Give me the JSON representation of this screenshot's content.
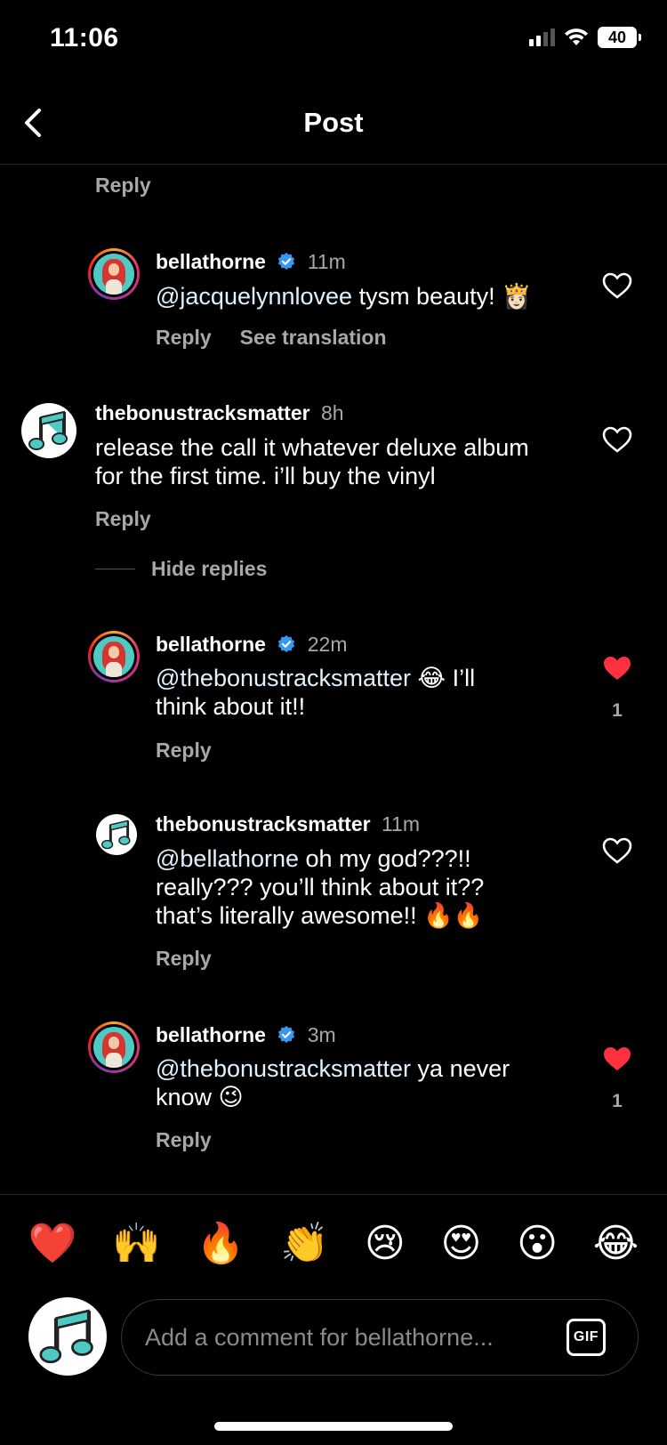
{
  "status": {
    "time": "11:06",
    "battery": "40"
  },
  "nav": {
    "title": "Post"
  },
  "top_reply_label": "Reply",
  "comments": [
    {
      "username": "bellathorne",
      "time": "11m",
      "mention": "@jacquelynnlovee",
      "text": " tysm beauty! 👸🏻",
      "reply": "Reply",
      "translate": "See translation"
    },
    {
      "username": "thebonustracksmatter",
      "time": "8h",
      "text_line1": "release the call it whatever deluxe album",
      "text_line2": "for the first time. i’ll buy the vinyl",
      "reply": "Reply"
    },
    {
      "username": "bellathorne",
      "time": "22m",
      "mention": "@thebonustracksmatter",
      "text_line1": " 😂 I’ll",
      "text_line2": "think about it!!",
      "reply": "Reply",
      "likes": "1"
    },
    {
      "username": "thebonustracksmatter",
      "time": "11m",
      "mention": "@bellathorne",
      "text_line1": " oh my god???!!",
      "text_line2": "really??? you’ll think about it??",
      "text_line3": "that’s literally awesome!! 🔥🔥",
      "reply": "Reply"
    },
    {
      "username": "bellathorne",
      "time": "3m",
      "mention": "@thebonustracksmatter",
      "text_line1": " ya never",
      "text_line2": "know 😉",
      "reply": "Reply",
      "likes": "1"
    }
  ],
  "hide_replies": "Hide replies",
  "emojis": [
    "❤️",
    "🙌",
    "🔥",
    "👏",
    "😢",
    "😍",
    "😮",
    "😂"
  ],
  "composer": {
    "placeholder": "Add a comment for bellathorne...",
    "gif_label": "GIF"
  },
  "colors": {
    "liked": "#ff3040",
    "verified": "#3897f0"
  }
}
